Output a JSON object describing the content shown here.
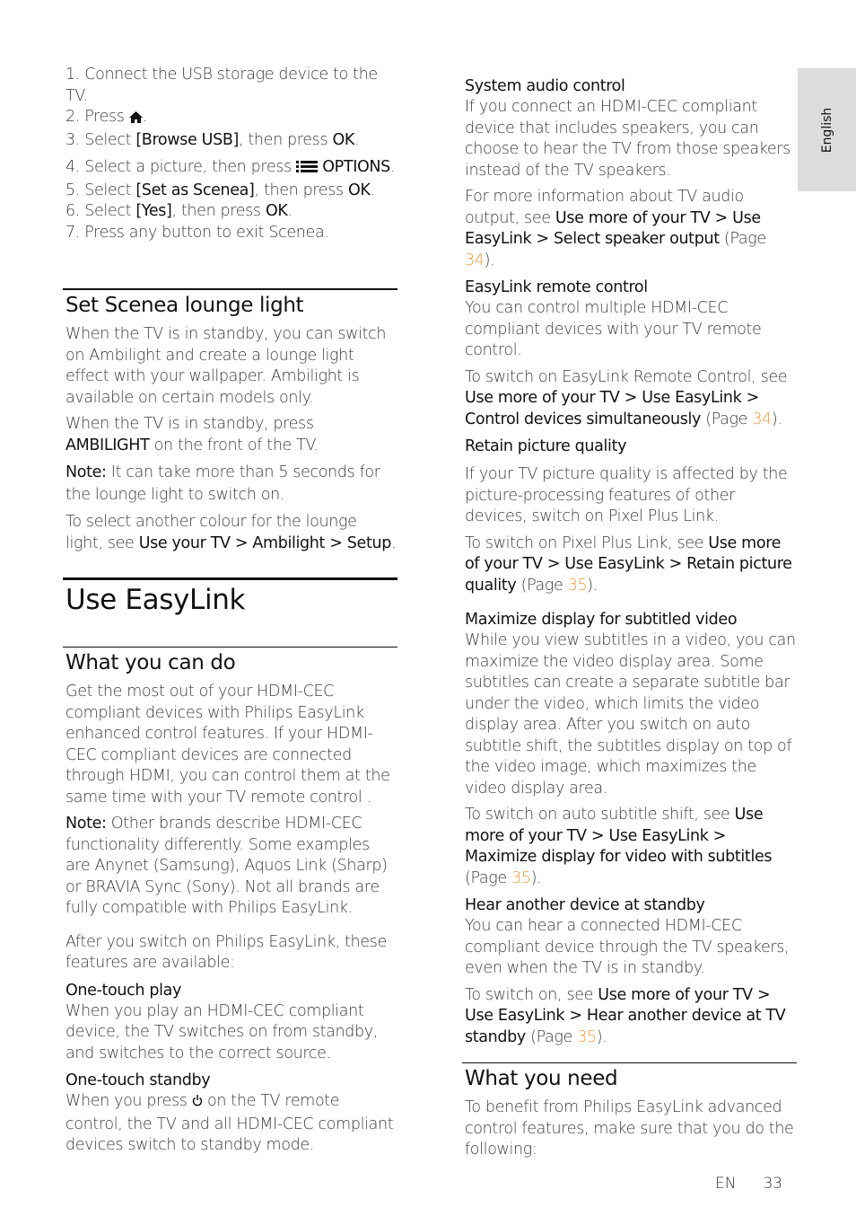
{
  "language_tab": "English",
  "steps": [
    {
      "n": "1.",
      "text": "Connect the USB storage device to the TV."
    },
    {
      "n": "2.",
      "pre": "Press",
      "icon": "home-icon",
      "post": "."
    },
    {
      "n": "3.",
      "pre": "Select",
      "bold": "[Browse USB]",
      "mid": ", then press",
      "bold2": "OK",
      "post": "."
    },
    {
      "n": "4.",
      "pre": "Select a picture, then press",
      "icon": "options-icon",
      "bold": "OPTIONS",
      "post": "."
    },
    {
      "n": "5.",
      "pre": "Select",
      "bold": "[Set as Scenea]",
      "mid": ", then press",
      "bold2": "OK",
      "post": "."
    },
    {
      "n": "6.",
      "pre": "Select",
      "bold": "[Yes]",
      "mid": ", then press",
      "bold2": "OK",
      "post": "."
    },
    {
      "n": "7.",
      "text": "Press any button to exit Scenea."
    }
  ],
  "lounge": {
    "title": "Set Scenea lounge light",
    "p1": "When the TV is in standby, you can switch on Ambilight and create a lounge light effect with your wallpaper. Ambilight is available on certain models only.",
    "p2_pre": "When the TV is in standby, press",
    "p2_bold": "AMBILIGHT",
    "p2_post": "on the front of the TV.",
    "note_label": "Note:",
    "note_text": "It can take more than 5 seconds for the lounge light to switch on.",
    "p4_pre": "To select another colour for the lounge light, see",
    "p4_bold": "Use your TV > Ambilight > Setup",
    "p4_post": "."
  },
  "easylink": {
    "title": "Use EasyLink",
    "what_title": "What you can do",
    "what_p1": "Get the most out of your HDMI-CEC compliant devices with Philips EasyLink enhanced control features. If your HDMI-CEC compliant devices are connected through HDMI, you can control them at the same time with your TV remote control .",
    "note_label": "Note:",
    "note_text": "Other brands describe HDMI-CEC functionality differently. Some examples are Anynet (Samsung), Aquos Link (Sharp) or BRAVIA Sync (Sony). Not all brands are fully compatible with Philips EasyLink.",
    "after": "After you switch on Philips EasyLink, these features are available:",
    "one_touch_play_title": "One-touch play",
    "one_touch_play_text": "When you play an HDMI-CEC compliant device, the TV switches on from standby, and switches to the correct source.",
    "one_touch_standby_title": "One-touch standby",
    "one_touch_standby_pre": "When you press",
    "one_touch_standby_post": "on the TV remote control, the TV and all HDMI-CEC compliant devices switch to standby mode."
  },
  "right": {
    "sys_title": "System audio control",
    "sys_p1": "If you connect an HDMI-CEC compliant device that includes speakers, you can choose to hear the TV from those speakers instead of the TV speakers.",
    "sys_p2_pre": "For more information about TV audio output, see",
    "sys_p2_bold": "Use more of your TV > Use EasyLink > Select speaker output",
    "sys_p2_page_pre": "(Page",
    "sys_p2_page": "34",
    "sys_p2_page_post": ").",
    "rc_title": "EasyLink remote control",
    "rc_p1": "You can control multiple HDMI-CEC compliant devices with your TV remote control.",
    "rc_p2_pre": "To switch on EasyLink Remote Control, see",
    "rc_p2_bold": "Use more of your TV > Use EasyLink > Control devices simultaneously",
    "rc_p2_page_pre": "(Page",
    "rc_p2_page": "34",
    "rc_p2_page_post": ").",
    "rpq_title": "Retain picture quality",
    "rpq_p1": "If your TV picture quality is affected by the picture-processing features of other devices, switch on Pixel Plus Link.",
    "rpq_p2_pre": "To switch on Pixel Plus Link, see",
    "rpq_p2_bold": "Use more of your TV > Use EasyLink > Retain picture quality",
    "rpq_p2_page_pre": "(Page",
    "rpq_p2_page": "35",
    "rpq_p2_page_post": ").",
    "max_title": "Maximize display for subtitled video",
    "max_p1": "While you view subtitles in a video, you can maximize the video display area. Some subtitles can create a separate subtitle bar under the video, which limits the video display area. After you switch on auto subtitle shift, the subtitles display on top of the video image, which maximizes the video display area.",
    "max_p2_pre": "To switch on auto subtitle shift, see",
    "max_p2_bold": "Use more of your TV > Use EasyLink > Maximize display for video with subtitles",
    "max_p2_page_pre": "(Page",
    "max_p2_page": "35",
    "max_p2_page_post": ").",
    "hear_title": "Hear another device at standby",
    "hear_p1": "You can hear a connected HDMI-CEC compliant device through the TV speakers, even when the TV is in standby.",
    "hear_p2_pre": "To switch on, see",
    "hear_p2_bold": "Use more of your TV > Use EasyLink > Hear another device at TV standby",
    "hear_p2_page_pre": "(Page",
    "hear_p2_page": "35",
    "hear_p2_page_post": ").",
    "need_title": "What you need",
    "need_p1": "To benefit from Philips EasyLink advanced control features, make sure that you do the following:"
  },
  "footer": {
    "lang": "EN",
    "page": "33"
  },
  "colors": {
    "link": "#f29a3b",
    "tab_bg": "#dcdcdc"
  }
}
